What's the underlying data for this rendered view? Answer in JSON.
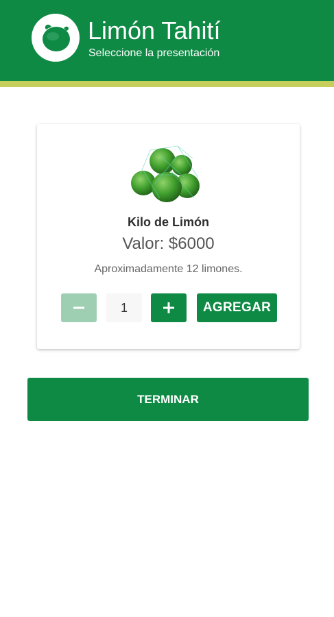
{
  "header": {
    "title": "Limón Tahití",
    "subtitle": "Seleccione la presentación",
    "logo_icon": "lemon-icon",
    "background_color": "#0f8a45",
    "stripe_color": "#c6cf5c"
  },
  "product": {
    "image_icon": "lemons-in-mesh-bag",
    "name": "Kilo de Limón",
    "price": "Valor: $6000",
    "description": "Aproximadamente 12 limones.",
    "quantity": "1",
    "decrement_icon": "minus-icon",
    "increment_icon": "plus-icon",
    "add_label": "AGREGAR"
  },
  "actions": {
    "finish_label": "TERMINAR"
  },
  "colors": {
    "primary": "#0f8a45",
    "primary_disabled": "#9fcfb3"
  }
}
